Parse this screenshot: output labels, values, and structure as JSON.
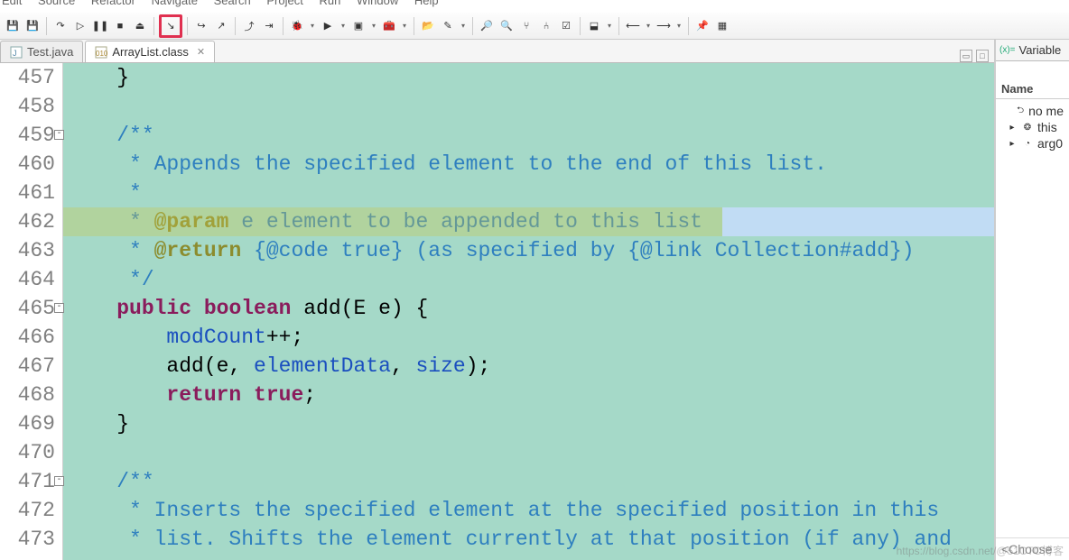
{
  "menu": {
    "items": [
      "Edit",
      "Source",
      "Refactor",
      "Navigate",
      "Search",
      "Project",
      "Run",
      "Window",
      "Help"
    ]
  },
  "toolbar": {
    "icons": [
      "save-icon",
      "save-all-icon",
      "sep",
      "skip-breakpoints-icon",
      "resume-icon",
      "pause-icon",
      "stop-icon",
      "disconnect-icon",
      "sep",
      "step-into-icon",
      "sep",
      "step-over-icon",
      "step-out-icon",
      "sep",
      "step-return-bp-icon",
      "run-to-line-icon",
      "sep",
      "bug-icon",
      "drop",
      "run-icon",
      "drop",
      "coverage-icon",
      "drop",
      "ext-tools-icon",
      "drop",
      "sep",
      "new-pkg-icon",
      "new-class-icon",
      "drop",
      "sep",
      "open-type-icon",
      "search-icon",
      "ann1-icon",
      "ann2-icon",
      "task-icon",
      "sep",
      "nav-drop-icon",
      "drop",
      "sep",
      "back-icon",
      "drop",
      "forward-icon",
      "drop",
      "sep",
      "pin-icon",
      "perspective-icon"
    ],
    "highlighted_index": 9
  },
  "tabs": {
    "items": [
      {
        "label": "Test.java",
        "active": false,
        "closeable": false
      },
      {
        "label": "ArrayList.class",
        "active": true,
        "closeable": true
      }
    ],
    "min_label": "▭",
    "max_label": "□"
  },
  "editor": {
    "first_line_no": 457,
    "current_line_no": 462,
    "fold_lines": [
      459,
      465,
      471
    ],
    "lines": [
      [
        {
          "cls": "tok-black",
          "t": "    }"
        }
      ],
      [
        {
          "cls": "",
          "t": ""
        }
      ],
      [
        {
          "cls": "tok-comment",
          "t": "    /**"
        }
      ],
      [
        {
          "cls": "tok-comment",
          "t": "     * Appends the specified element to the end of this list."
        }
      ],
      [
        {
          "cls": "tok-comment",
          "t": "     *"
        }
      ],
      [
        {
          "cls": "tok-comment",
          "t": "     * "
        },
        {
          "cls": "tok-doctag",
          "t": "@param"
        },
        {
          "cls": "tok-comment",
          "t": " e element to be appended to this list"
        }
      ],
      [
        {
          "cls": "tok-comment",
          "t": "     * "
        },
        {
          "cls": "tok-doctag",
          "t": "@return"
        },
        {
          "cls": "tok-comment",
          "t": " {@code true} (as specified by {@link Collection#add})"
        }
      ],
      [
        {
          "cls": "tok-comment",
          "t": "     */"
        }
      ],
      [
        {
          "cls": "",
          "t": "    "
        },
        {
          "cls": "tok-keyword",
          "t": "public boolean"
        },
        {
          "cls": "tok-black",
          "t": " add(E e) {"
        }
      ],
      [
        {
          "cls": "",
          "t": "        "
        },
        {
          "cls": "tok-field",
          "t": "modCount"
        },
        {
          "cls": "tok-black",
          "t": "++;"
        }
      ],
      [
        {
          "cls": "tok-black",
          "t": "        add(e, "
        },
        {
          "cls": "tok-field",
          "t": "elementData"
        },
        {
          "cls": "tok-black",
          "t": ", "
        },
        {
          "cls": "tok-field",
          "t": "size"
        },
        {
          "cls": "tok-black",
          "t": ");"
        }
      ],
      [
        {
          "cls": "",
          "t": "        "
        },
        {
          "cls": "tok-keyword",
          "t": "return true"
        },
        {
          "cls": "tok-black",
          "t": ";"
        }
      ],
      [
        {
          "cls": "tok-black",
          "t": "    }"
        }
      ],
      [
        {
          "cls": "",
          "t": ""
        }
      ],
      [
        {
          "cls": "tok-comment",
          "t": "    /**"
        }
      ],
      [
        {
          "cls": "tok-comment",
          "t": "     * Inserts the specified element at the specified position in this"
        }
      ],
      [
        {
          "cls": "tok-comment",
          "t": "     * list. Shifts the element currently at that position (if any) and"
        }
      ]
    ]
  },
  "variables_panel": {
    "title": "Variable",
    "header": "Name",
    "rows": [
      {
        "icon": "ret-icon",
        "label": "no me"
      },
      {
        "icon": "this-icon",
        "label": "this"
      },
      {
        "icon": "arg-icon",
        "label": "arg0"
      }
    ],
    "choose_label": "<Choose"
  },
  "watermark": "https://blog.csdn.net/@51CTO博客"
}
